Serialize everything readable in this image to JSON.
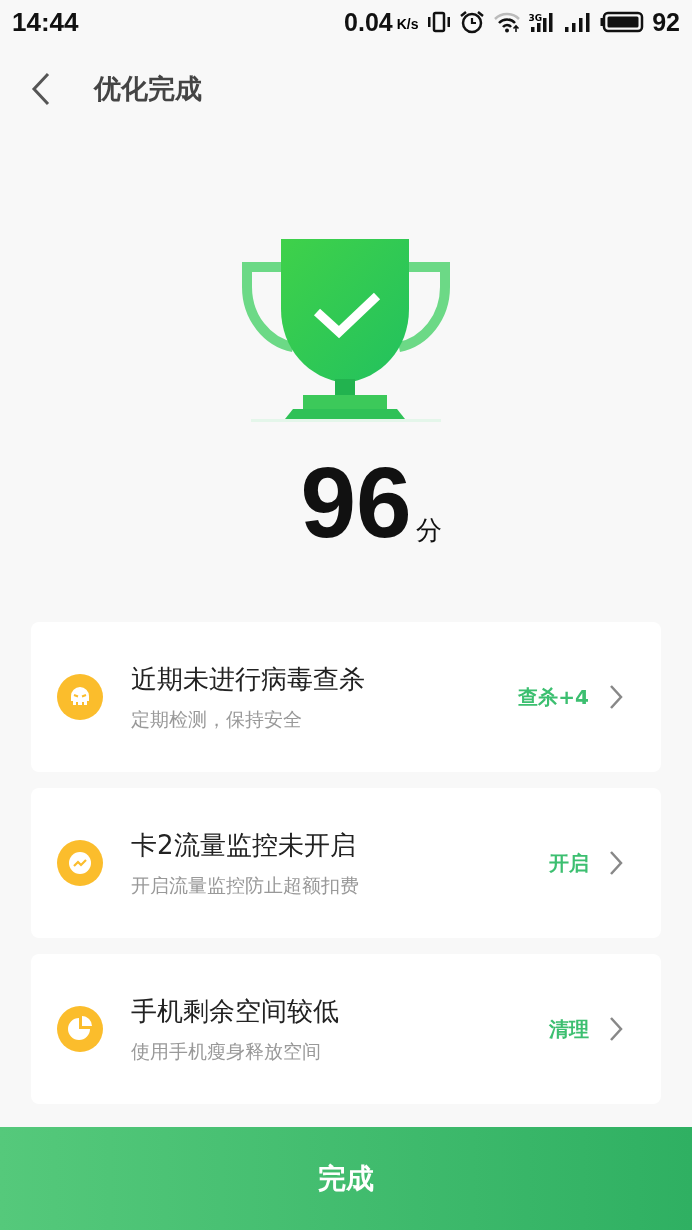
{
  "status_bar": {
    "time": "14:44",
    "speed": "0.04",
    "speed_unit": "K/s",
    "network": "3G",
    "battery": "92"
  },
  "header": {
    "title": "优化完成"
  },
  "score": {
    "value": "96",
    "unit": "分"
  },
  "items": [
    {
      "kind": "skull",
      "title": "近期未进行病毒查杀",
      "subtitle": "定期检测，保持安全",
      "action": "查杀+4"
    },
    {
      "kind": "chart",
      "title": "卡2流量监控未开启",
      "subtitle": "开启流量监控防止超额扣费",
      "action": "开启"
    },
    {
      "kind": "pie",
      "title": "手机剩余空间较低",
      "subtitle": "使用手机瘦身释放空间",
      "action": "清理"
    }
  ],
  "done_button": "完成"
}
